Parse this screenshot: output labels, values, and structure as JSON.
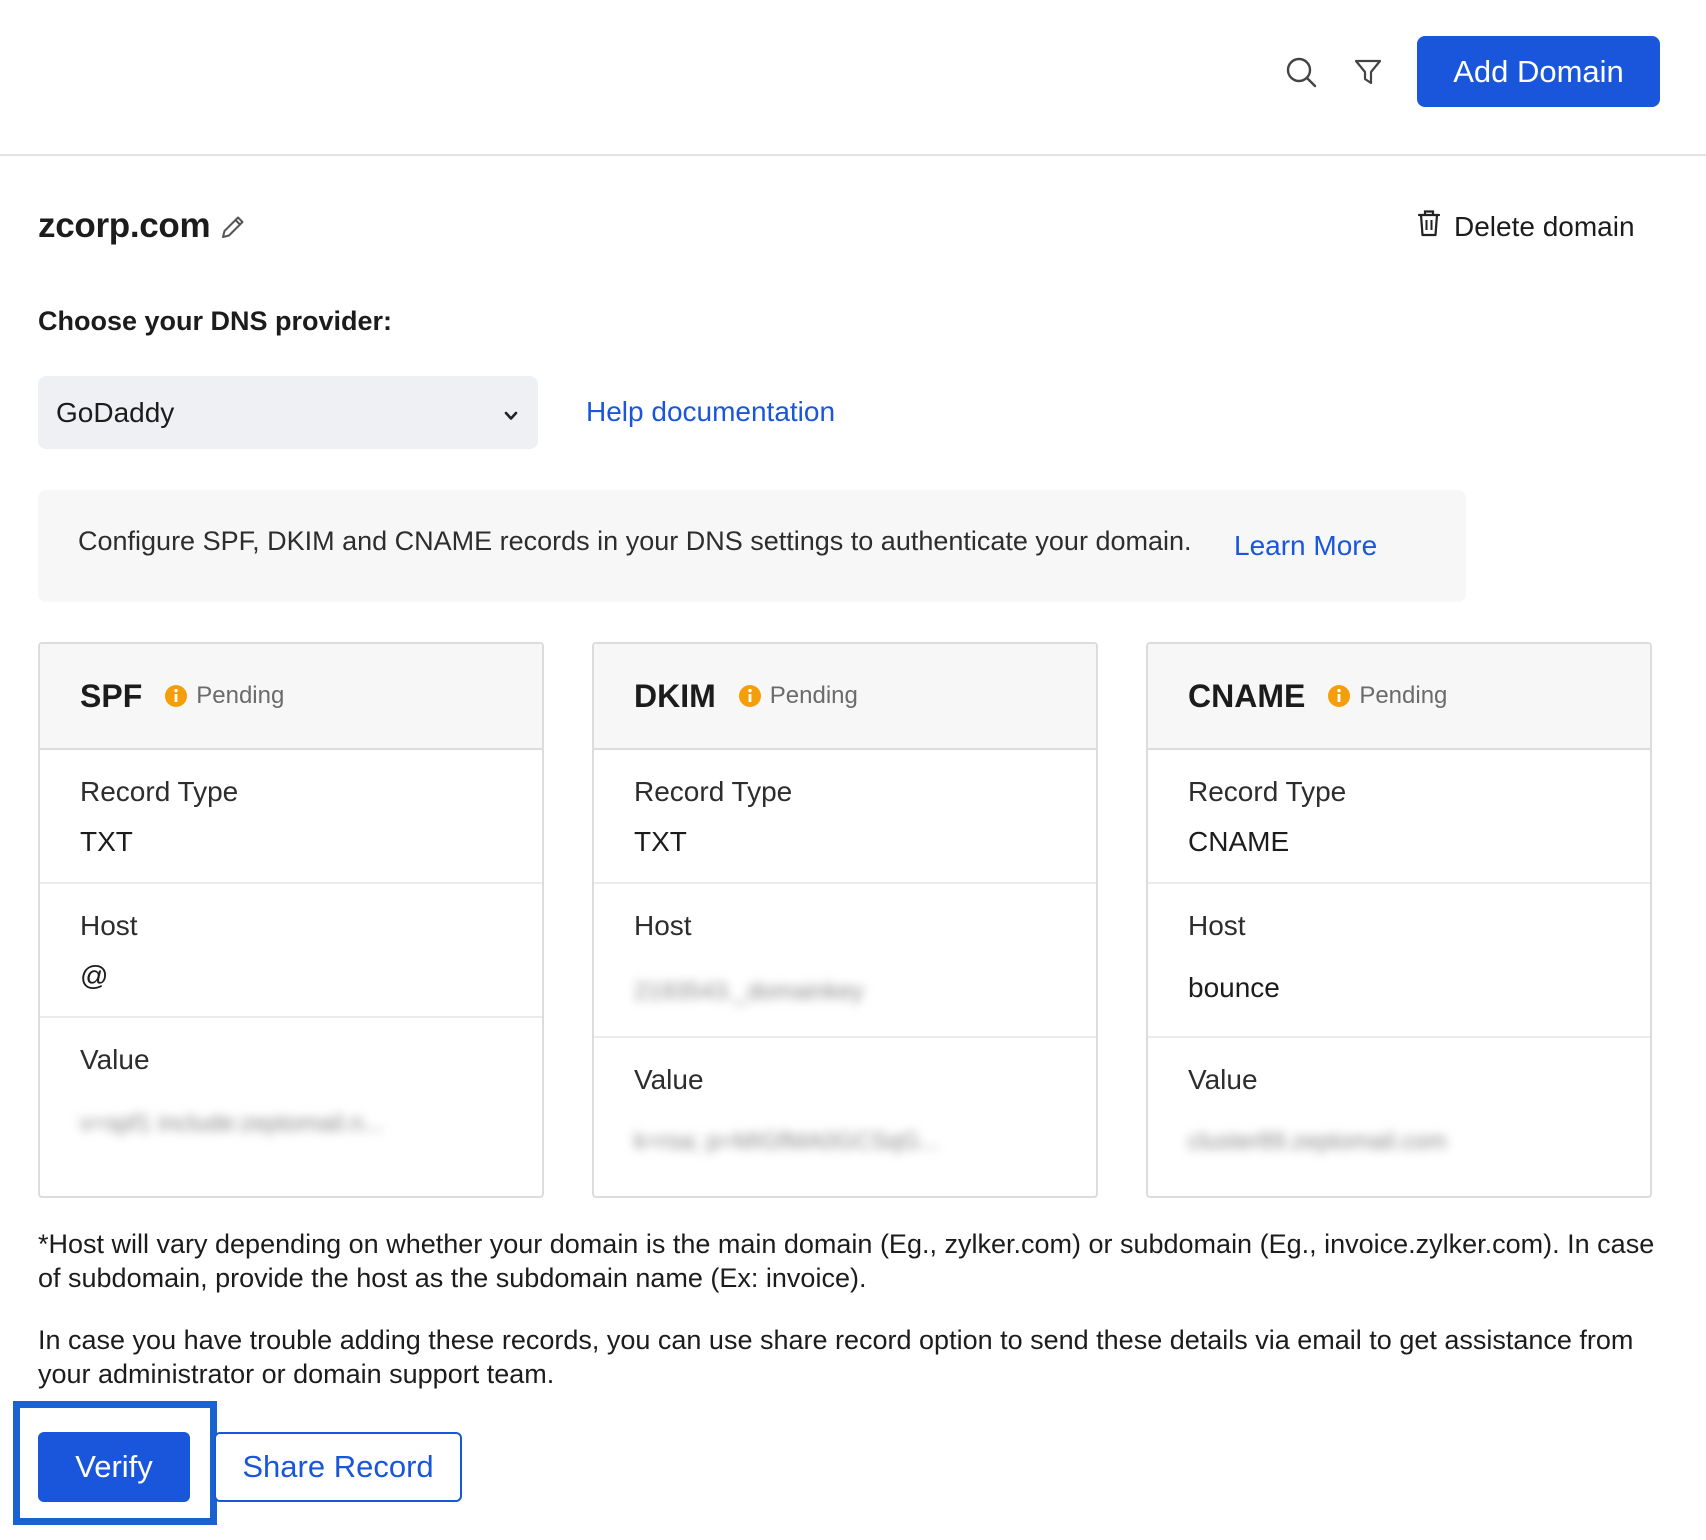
{
  "toolbar": {
    "search_icon": "search-icon",
    "filter_icon": "filter-icon",
    "add_domain_label": "Add Domain"
  },
  "domain": {
    "name": "zcorp.com",
    "delete_label": "Delete domain"
  },
  "dns": {
    "label": "Choose your DNS provider:",
    "selected": "GoDaddy",
    "help_link": "Help documentation"
  },
  "info": {
    "text": "Configure SPF, DKIM and CNAME records in your DNS settings to authenticate your domain.",
    "learn_more": "Learn More"
  },
  "cards": [
    {
      "title": "SPF",
      "status": "Pending",
      "record_type_label": "Record Type",
      "record_type": "TXT",
      "host_label": "Host",
      "host": "@",
      "value_label": "Value",
      "value": "v=spf1 include:zeptomail.n..."
    },
    {
      "title": "DKIM",
      "status": "Pending",
      "record_type_label": "Record Type",
      "record_type": "TXT",
      "host_label": "Host",
      "host": "2193543._domainkey",
      "value_label": "Value",
      "value": "k=rsa; p=MIGfMA0GCSqG..."
    },
    {
      "title": "CNAME",
      "status": "Pending",
      "record_type_label": "Record Type",
      "record_type": "CNAME",
      "host_label": "Host",
      "host": "bounce",
      "value_label": "Value",
      "value": "cluster89.zeptomail.com"
    }
  ],
  "notes": {
    "host_note": "*Host will vary depending on whether your domain is the main domain (Eg., zylker.com) or subdomain (Eg., invoice.zylker.com). In case of subdomain, provide the host as the subdomain name (Ex: invoice).",
    "share_note": "In case you have trouble adding these records, you can use share record option to send these details via email to get assistance from your administrator or domain support team."
  },
  "actions": {
    "verify_label": "Verify",
    "share_label": "Share Record"
  },
  "colors": {
    "primary": "#1a56db",
    "pending": "#f59e0b",
    "highlight": "#1a62d0"
  }
}
